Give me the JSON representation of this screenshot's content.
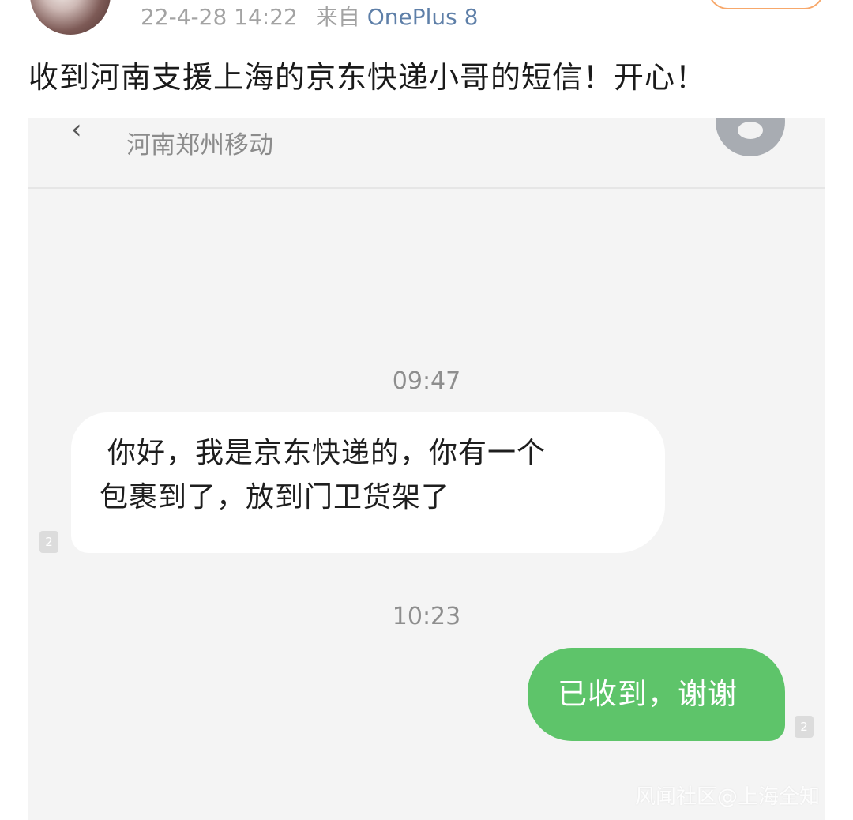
{
  "post": {
    "timestamp": "22-4-28 14:22",
    "source_prefix": "来自",
    "device": "OnePlus 8",
    "text": "收到河南支援上海的京东快递小哥的短信！开心！"
  },
  "sms": {
    "back_icon": "chevron-left-icon",
    "carrier": "河南郑州移动",
    "messages": [
      {
        "time": "09:47",
        "direction": "incoming",
        "line1": "你好，我是京东快递的，你有一个",
        "line2": "包裹到了，放到门卫货架了",
        "sim": "2"
      },
      {
        "time": "10:23",
        "direction": "outgoing",
        "text": "已收到，谢谢",
        "sim": "2"
      }
    ],
    "watermark": "风闻社区@上海全知"
  },
  "colors": {
    "outgoing_bubble": "#5ec46a",
    "incoming_bubble": "#ffffff",
    "device_link": "#5e7fa8",
    "follow_border": "#f7a86b"
  }
}
